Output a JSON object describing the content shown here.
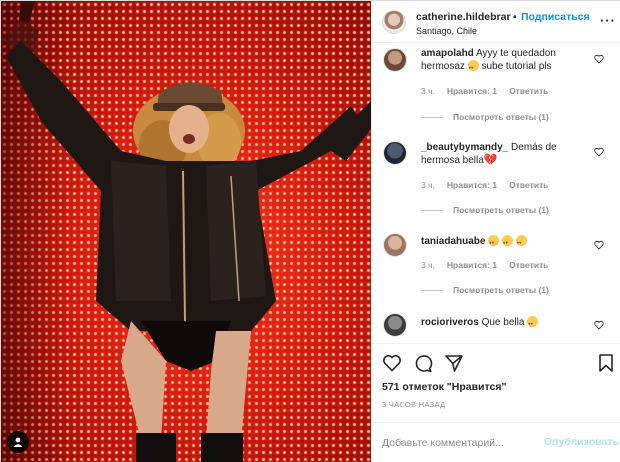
{
  "header": {
    "username": "catherine.hildebrar",
    "dot": "•",
    "follow_label": "Подписаться",
    "location": "Santiago, Chile",
    "more_label": "···"
  },
  "comments": [
    {
      "username": "amapolahd",
      "text": "Ayyy te quedadon hermosaz",
      "emoji": "heart-eyes",
      "text_after": "sube tutorial pls",
      "time": "3 ч.",
      "likes": "Нравится: 1",
      "reply": "Ответить",
      "view_replies": "Посмотреть ответы (1)"
    },
    {
      "username": "_beautybymandy_",
      "text": "Demás de hermosa bella",
      "emoji": "broken-heart",
      "time": "3 ч.",
      "likes": "Нравится: 1",
      "reply": "Ответить",
      "view_replies": "Посмотреть ответы (1)"
    },
    {
      "username": "taniadahuabe",
      "text": "",
      "emoji": "heart-eyes x3",
      "time": "3 ч.",
      "likes": "Нравится: 1",
      "reply": "Ответить",
      "view_replies": "Посмотреть ответы (1)"
    },
    {
      "username": "rocioriveros",
      "text": "Que bella",
      "emoji": "heart-eyes"
    }
  ],
  "actions": {
    "likes_text": "571 отметок \"Нравится\"",
    "time_ago": "3 ЧАСОВ НАЗАД"
  },
  "composer": {
    "placeholder": "Добавьте комментарий...",
    "publish_label": "Опубликовать"
  },
  "colors": {
    "accent": "#0095f6",
    "muted": "#8e8e8e",
    "publish_disabled": "#b2dffc",
    "stage_red": "#d41a10"
  }
}
